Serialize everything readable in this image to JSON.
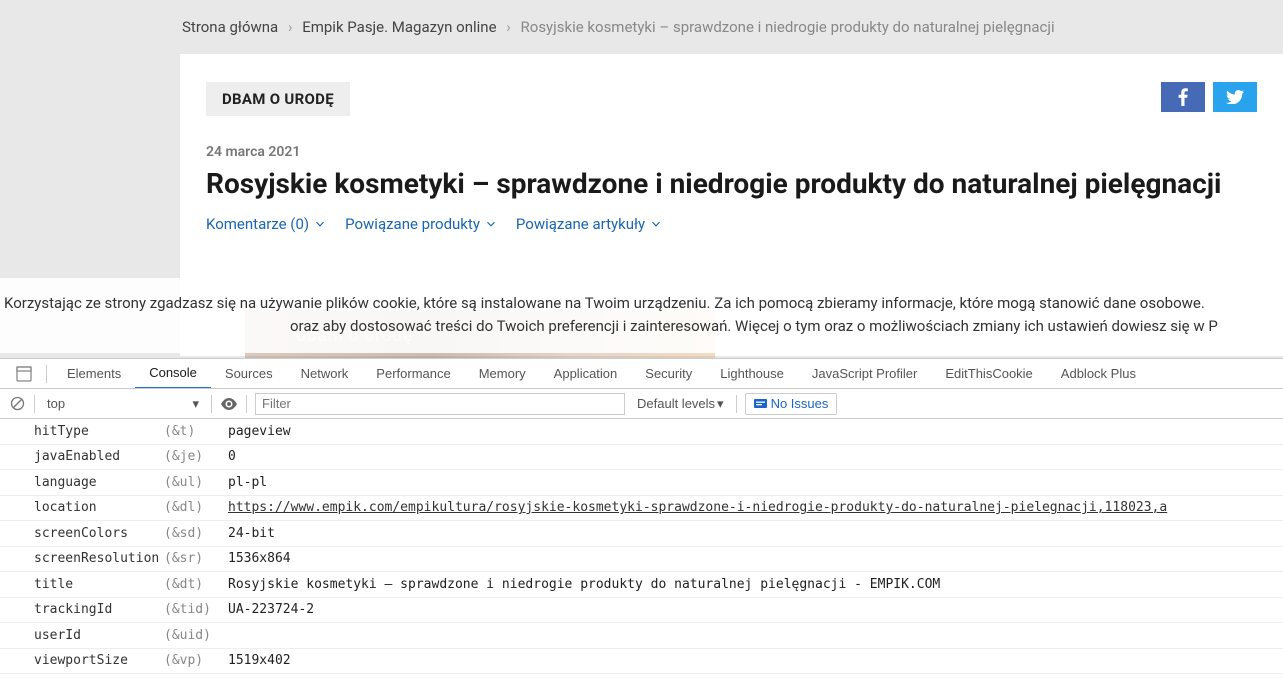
{
  "breadcrumb": {
    "home": "Strona główna",
    "magazine": "Empik Pasje. Magazyn online",
    "current": "Rosyjskie kosmetyki – sprawdzone i niedrogie produkty do naturalnej pielęgnacji"
  },
  "article": {
    "tag": "DBAM O URODĘ",
    "date": "24 marca 2021",
    "title": "Rosyjskie kosmetyki – sprawdzone i niedrogie produkty do naturalnej pielęgnacji",
    "links": {
      "comments": "Komentarze (0)",
      "related_products": "Powiązane produkty",
      "related_articles": "Powiązane artykuły"
    },
    "behind_label": "dbam o urodę"
  },
  "cookie_banner": {
    "line1": "Korzystając ze strony zgadzasz się na używanie plików cookie, które są instalowane na Twoim urządzeniu. Za ich pomocą zbieramy informacje, które mogą stanowić dane osobowe.",
    "line2": "oraz aby dostosować treści do Twoich preferencji i zainteresowań. Więcej o tym oraz o możliwościach zmiany ich ustawień dowiesz się w P"
  },
  "devtools": {
    "tabs": [
      "Elements",
      "Console",
      "Sources",
      "Network",
      "Performance",
      "Memory",
      "Application",
      "Security",
      "Lighthouse",
      "JavaScript Profiler",
      "EditThisCookie",
      "Adblock Plus"
    ],
    "active_tab_index": 1,
    "toolbar": {
      "context": "top",
      "filter_placeholder": "Filter",
      "levels": "Default levels",
      "issues": "No Issues"
    },
    "rows": [
      {
        "name": "hitType",
        "param": "(&t)",
        "value": "pageview"
      },
      {
        "name": "javaEnabled",
        "param": "(&je)",
        "value": "0"
      },
      {
        "name": "language",
        "param": "(&ul)",
        "value": "pl-pl"
      },
      {
        "name": "location",
        "param": "(&dl)",
        "value": "https://www.empik.com/empikultura/rosyjskie-kosmetyki-sprawdzone-i-niedrogie-produkty-do-naturalnej-pielegnacji,118023,a",
        "link": true
      },
      {
        "name": "screenColors",
        "param": "(&sd)",
        "value": "24-bit"
      },
      {
        "name": "screenResolution",
        "param": "(&sr)",
        "value": "1536x864"
      },
      {
        "name": "title",
        "param": "(&dt)",
        "value": "Rosyjskie kosmetyki – sprawdzone i niedrogie produkty do naturalnej pielęgnacji - EMPIK.COM"
      },
      {
        "name": "trackingId",
        "param": "(&tid)",
        "value": "UA-223724-2"
      },
      {
        "name": "userId",
        "param": "(&uid)",
        "value": ""
      },
      {
        "name": "viewportSize",
        "param": "(&vp)",
        "value": "1519x402"
      }
    ]
  }
}
